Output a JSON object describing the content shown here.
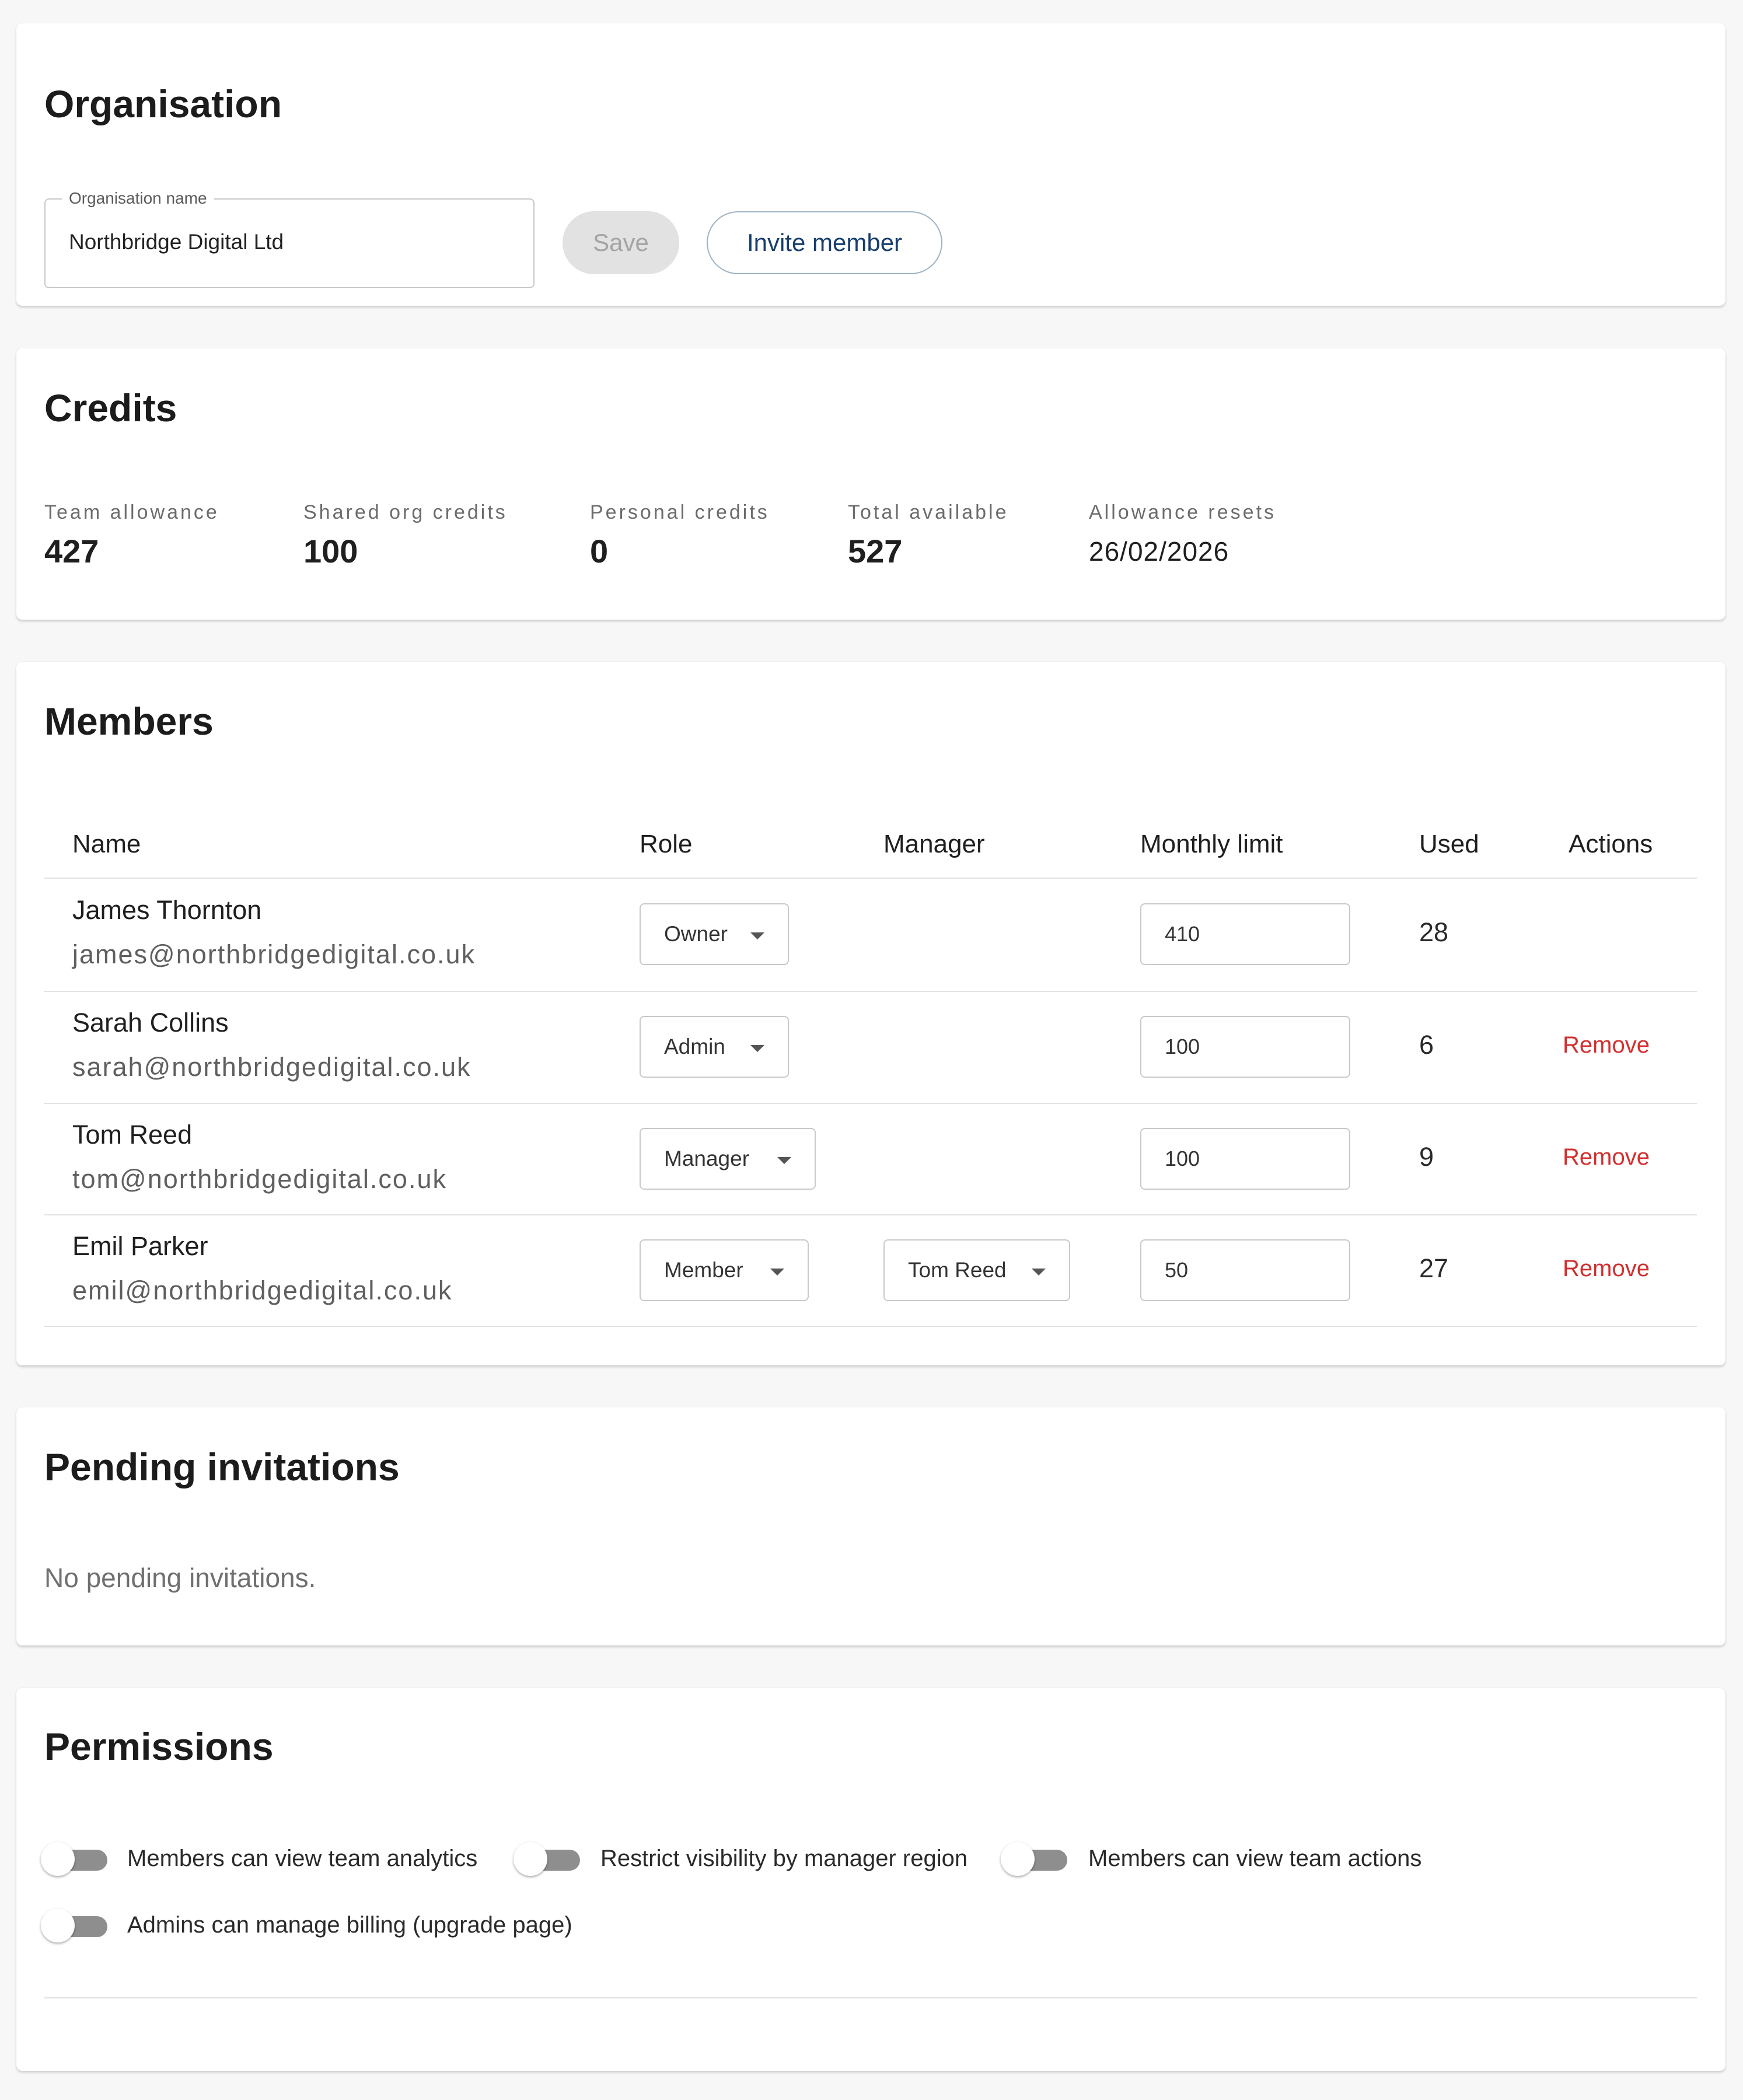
{
  "organisation": {
    "title": "Organisation",
    "name_field": {
      "label": "Organisation name",
      "value": "Northbridge Digital Ltd"
    },
    "save_label": "Save",
    "invite_label": "Invite member"
  },
  "credits": {
    "title": "Credits",
    "stats": [
      {
        "label": "Team allowance",
        "value": "427"
      },
      {
        "label": "Shared org credits",
        "value": "100"
      },
      {
        "label": "Personal credits",
        "value": "0"
      },
      {
        "label": "Total available",
        "value": "527"
      },
      {
        "label": "Allowance resets",
        "value": "26/02/2026"
      }
    ]
  },
  "members": {
    "title": "Members",
    "columns": [
      "Name",
      "Role",
      "Manager",
      "Monthly limit",
      "Used",
      "Actions"
    ],
    "rows": [
      {
        "name": "James Thornton",
        "email": "james@northbridgedigital.co.uk",
        "role": "Owner",
        "manager": "",
        "limit": "410",
        "used": "28",
        "action": ""
      },
      {
        "name": "Sarah Collins",
        "email": "sarah@northbridgedigital.co.uk",
        "role": "Admin",
        "manager": "",
        "limit": "100",
        "used": "6",
        "action": "Remove"
      },
      {
        "name": "Tom Reed",
        "email": "tom@northbridgedigital.co.uk",
        "role": "Manager",
        "manager": "",
        "limit": "100",
        "used": "9",
        "action": "Remove"
      },
      {
        "name": "Emil Parker",
        "email": "emil@northbridgedigital.co.uk",
        "role": "Member",
        "manager": "Tom Reed",
        "limit": "50",
        "used": "27",
        "action": "Remove"
      }
    ]
  },
  "pending": {
    "title": "Pending invitations",
    "empty_text": "No pending invitations."
  },
  "permissions": {
    "title": "Permissions",
    "toggles": [
      {
        "label": "Members can view team analytics",
        "on": false
      },
      {
        "label": "Restrict visibility by manager region",
        "on": false
      },
      {
        "label": "Members can view team actions",
        "on": false
      },
      {
        "label": "Admins can manage billing (upgrade page)",
        "on": false
      }
    ]
  },
  "colors": {
    "accent_text": "#173e6e",
    "danger": "#d32f2f",
    "toggle_off_track": "#8e8e8e",
    "card_bg": "#ffffff",
    "page_bg": "#f7f7f7"
  }
}
